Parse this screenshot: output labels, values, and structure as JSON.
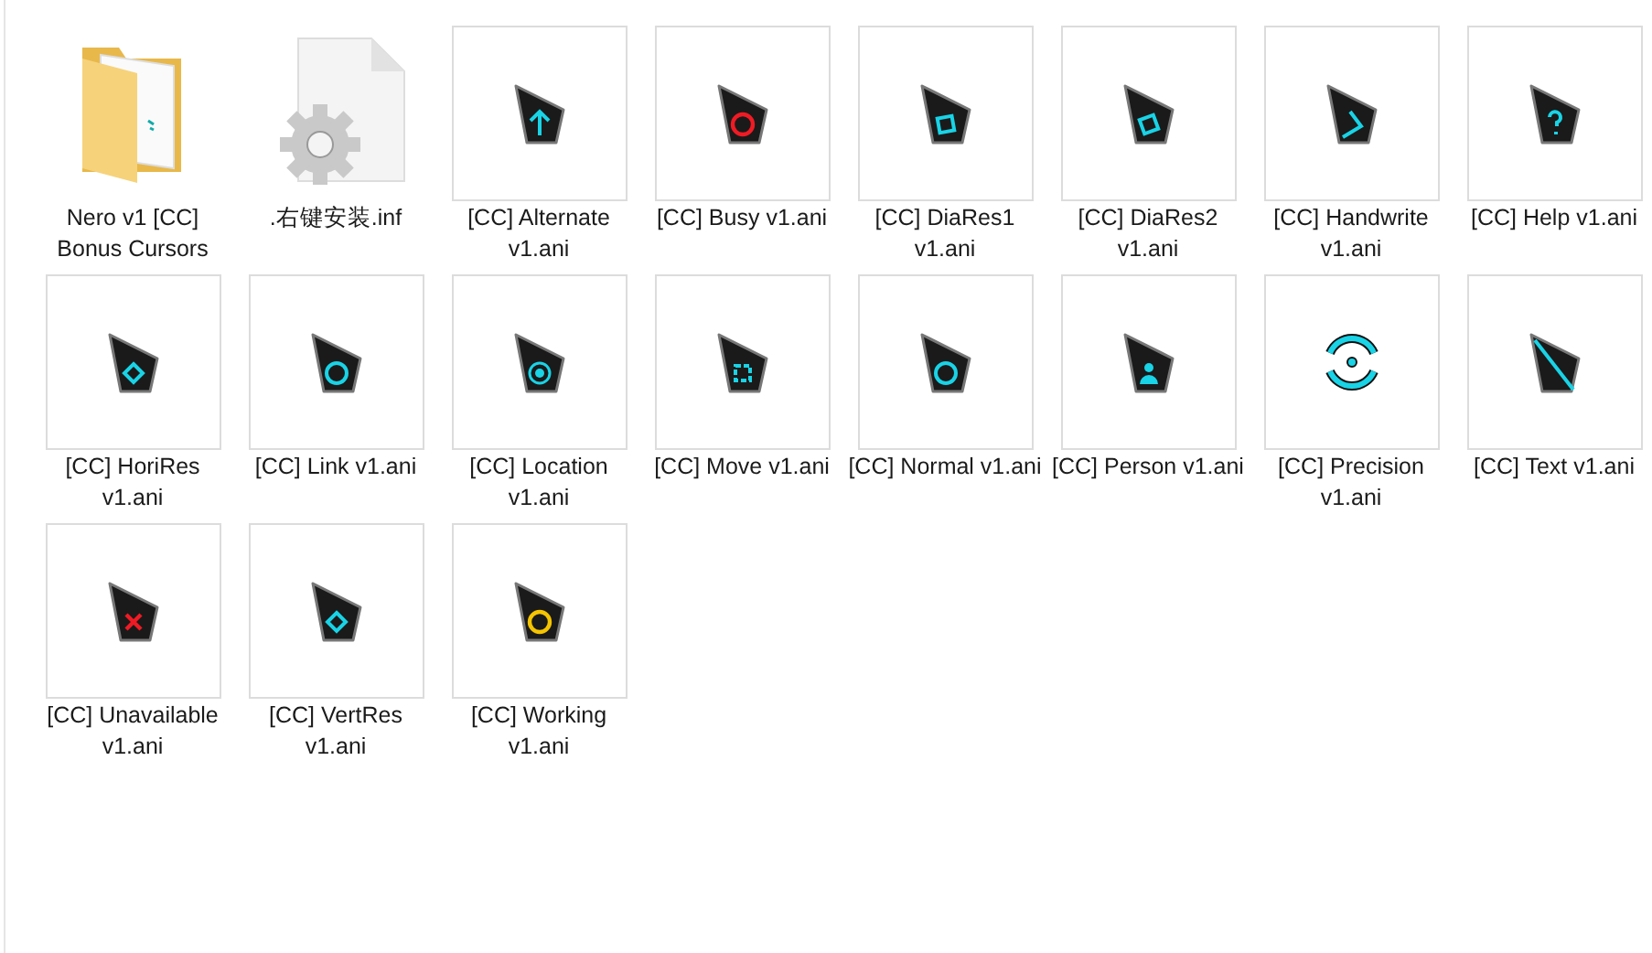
{
  "items": [
    {
      "kind": "folder",
      "label": "Nero v1 [CC] Bonus Cursors"
    },
    {
      "kind": "settings-file",
      "label": ".右键安装.inf"
    },
    {
      "kind": "cursor",
      "label": "[CC] Alternate v1.ani"
    },
    {
      "kind": "cursor",
      "label": "[CC] Busy v1.ani"
    },
    {
      "kind": "cursor",
      "label": "[CC] DiaRes1 v1.ani"
    },
    {
      "kind": "cursor",
      "label": "[CC] DiaRes2 v1.ani"
    },
    {
      "kind": "cursor",
      "label": "[CC] Handwrite v1.ani"
    },
    {
      "kind": "cursor",
      "label": "[CC] Help v1.ani"
    },
    {
      "kind": "cursor",
      "label": "[CC] HoriRes v1.ani"
    },
    {
      "kind": "cursor",
      "label": "[CC] Link v1.ani"
    },
    {
      "kind": "cursor",
      "label": "[CC] Location v1.ani"
    },
    {
      "kind": "cursor",
      "label": "[CC] Move v1.ani"
    },
    {
      "kind": "cursor",
      "label": "[CC] Normal v1.ani"
    },
    {
      "kind": "cursor",
      "label": "[CC] Person v1.ani"
    },
    {
      "kind": "precision",
      "label": "[CC] Precision v1.ani"
    },
    {
      "kind": "cursor",
      "label": "[CC] Text v1.ani"
    },
    {
      "kind": "cursor",
      "label": "[CC] Unavailable v1.ani"
    },
    {
      "kind": "cursor",
      "label": "[CC] VertRes v1.ani"
    },
    {
      "kind": "cursor",
      "label": "[CC] Working v1.ani"
    }
  ]
}
